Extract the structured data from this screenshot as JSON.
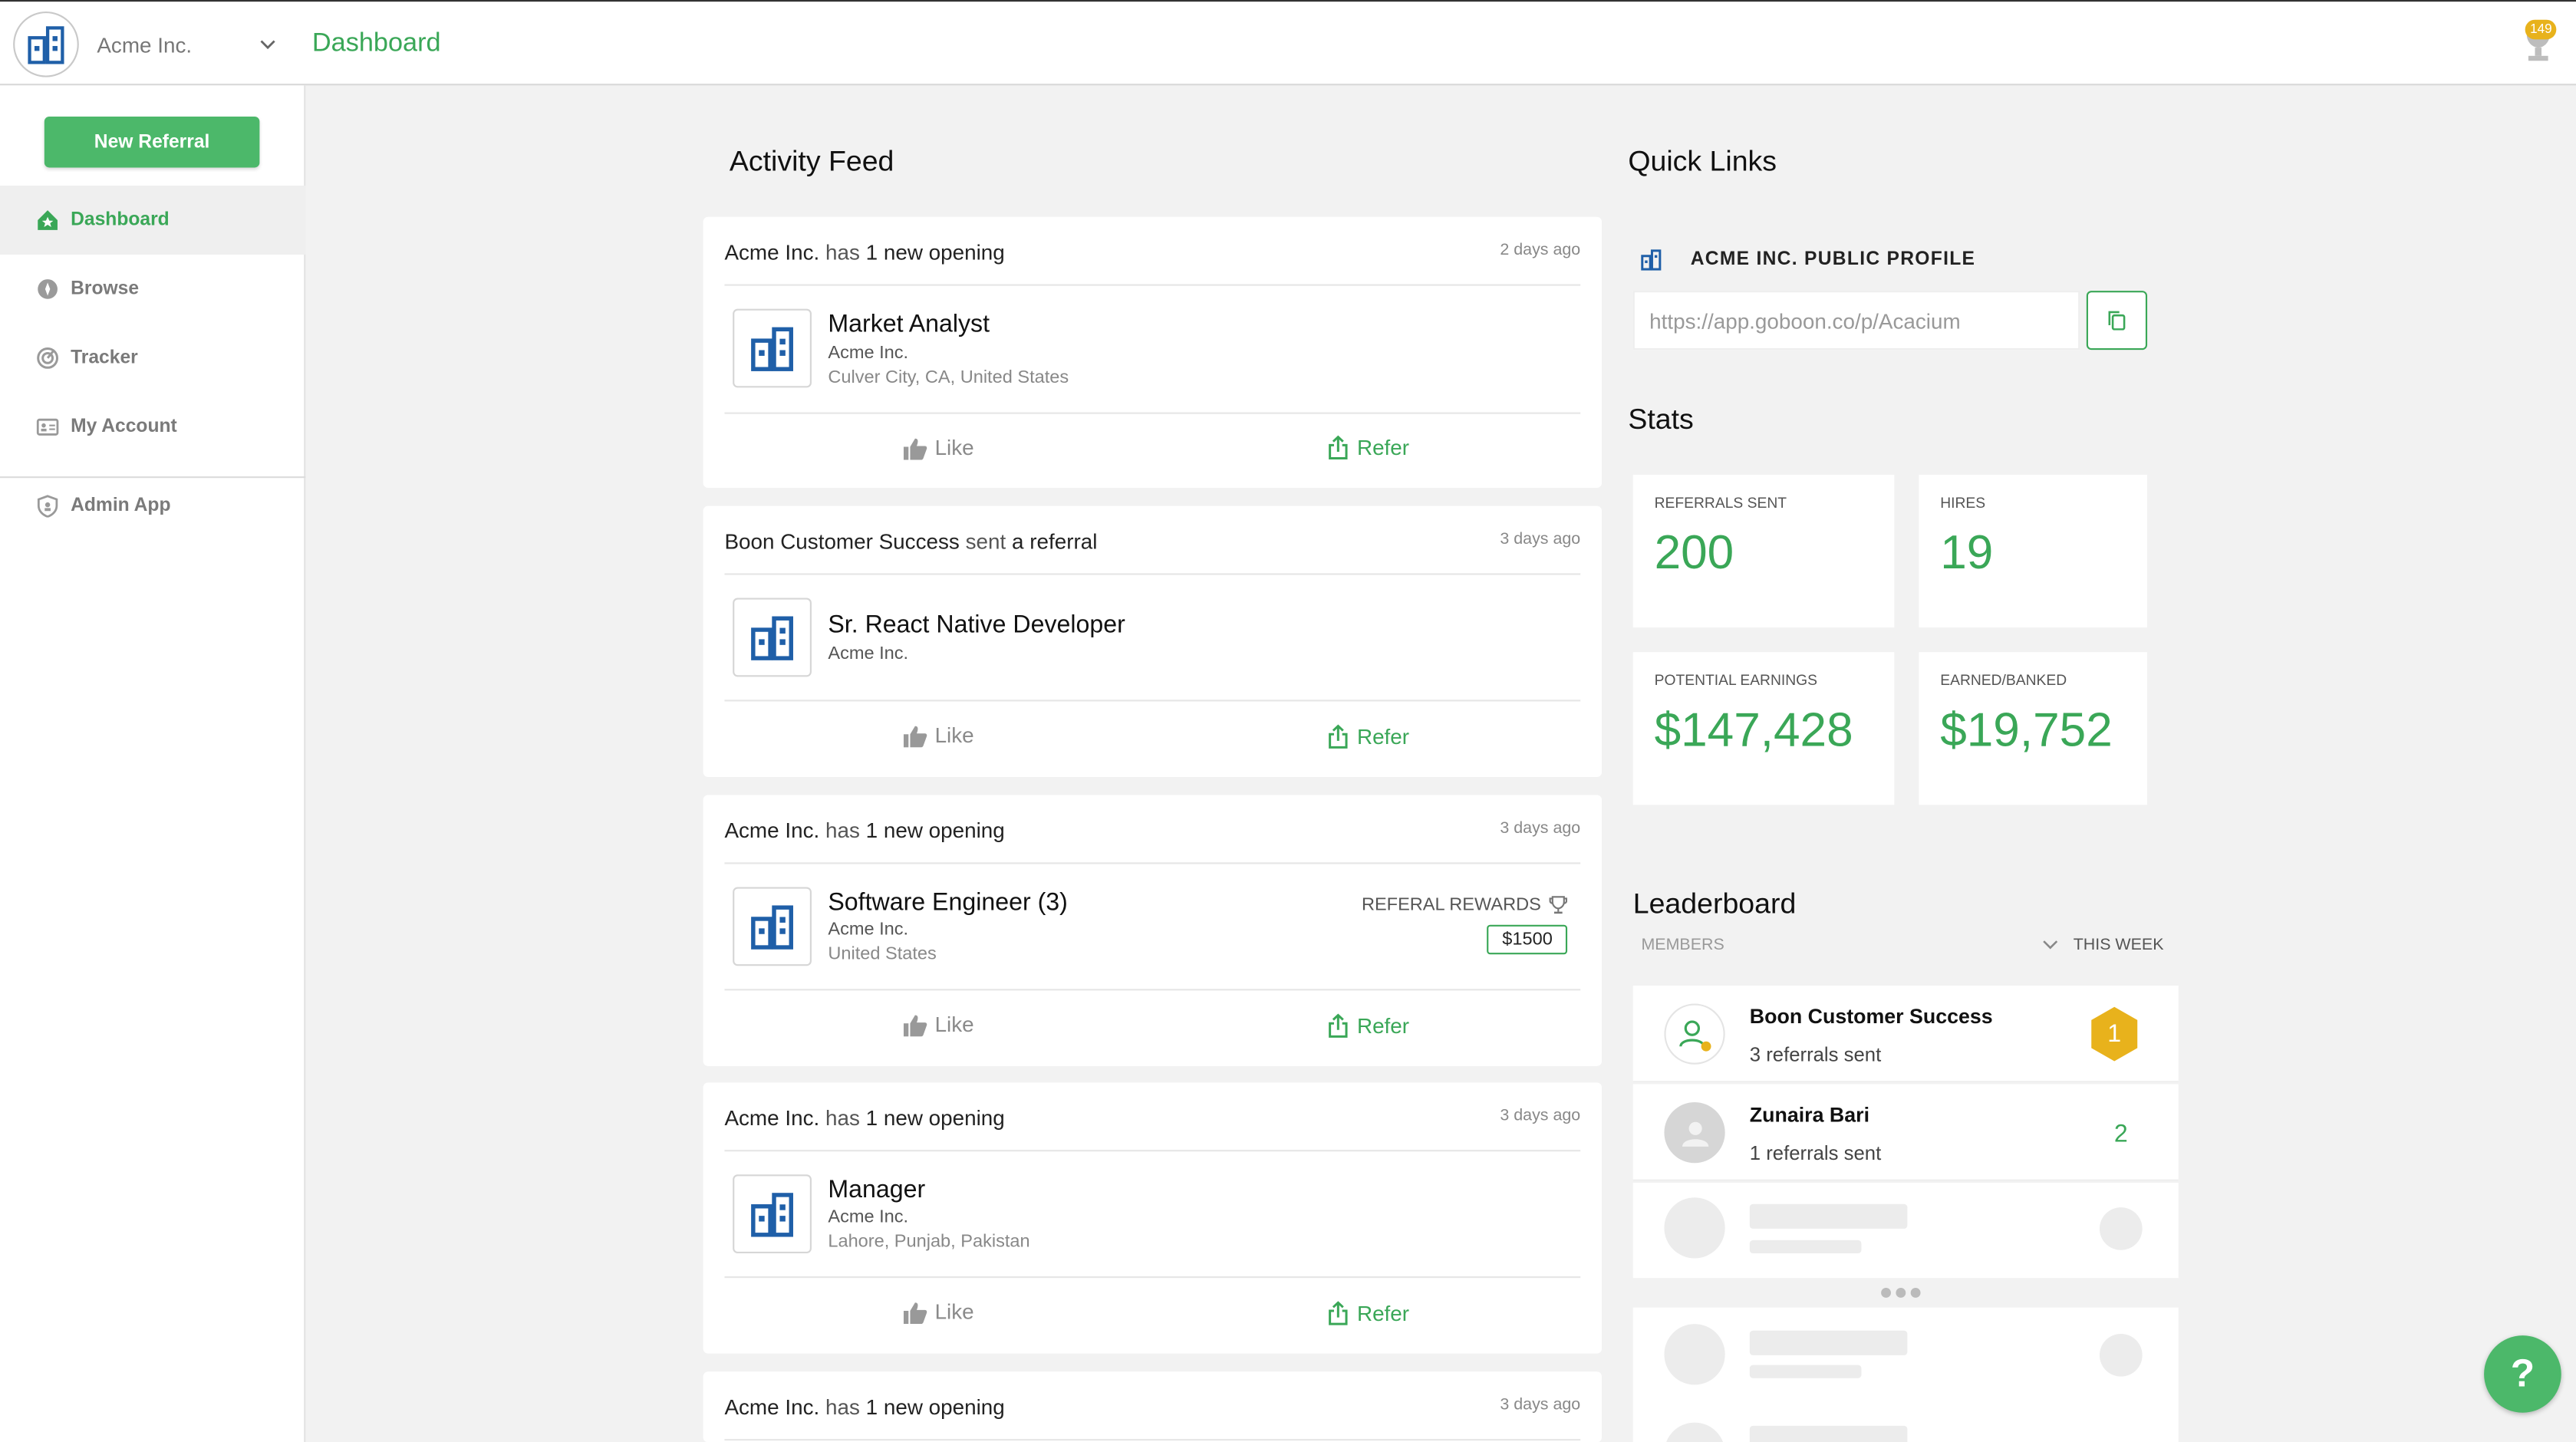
{
  "header": {
    "org_name": "Acme Inc.",
    "title": "Dashboard",
    "notification_count": "149"
  },
  "sidebar": {
    "new_referral": "New Referral",
    "items": [
      {
        "label": "Dashboard",
        "icon": "home-icon",
        "active": true
      },
      {
        "label": "Browse",
        "icon": "compass-icon"
      },
      {
        "label": "Tracker",
        "icon": "radar-icon"
      },
      {
        "label": "My Account",
        "icon": "id-card-icon"
      },
      {
        "label": "Admin App",
        "icon": "shield-icon"
      }
    ]
  },
  "feed": {
    "title": "Activity Feed",
    "like_label": "Like",
    "refer_label": "Refer",
    "cards": [
      {
        "actor": "Acme Inc.",
        "verb": "has",
        "object": "1 new opening",
        "time": "2 days ago",
        "job_title": "Market Analyst",
        "company": "Acme Inc.",
        "location": "Culver City, CA, United States"
      },
      {
        "actor": "Boon Customer Success",
        "verb": "sent",
        "object": "a referral",
        "time": "3 days ago",
        "job_title": "Sr. React Native Developer",
        "company": "Acme Inc.",
        "location": ""
      },
      {
        "actor": "Acme Inc.",
        "verb": "has",
        "object": "1 new opening",
        "time": "3 days ago",
        "job_title": "Software Engineer (3)",
        "company": "Acme Inc.",
        "location": "United States",
        "rewards_label": "REFERAL REWARDS",
        "rewards_amount": "$1500"
      },
      {
        "actor": "Acme Inc.",
        "verb": "has",
        "object": "1 new opening",
        "time": "3 days ago",
        "job_title": "Manager",
        "company": "Acme Inc.",
        "location": "Lahore, Punjab, Pakistan"
      },
      {
        "actor": "Acme Inc.",
        "verb": "has",
        "object": "1 new opening",
        "time": "3 days ago"
      }
    ]
  },
  "quick_links": {
    "title": "Quick Links",
    "profile_label": "ACME INC. PUBLIC PROFILE",
    "profile_url": "https://app.goboon.co/p/Acacium"
  },
  "stats": {
    "title": "Stats",
    "items": [
      {
        "label": "REFERRALS SENT",
        "value": "200"
      },
      {
        "label": "HIRES",
        "value": "19"
      },
      {
        "label": "POTENTIAL EARNINGS",
        "value": "$147,428"
      },
      {
        "label": "EARNED/BANKED",
        "value": "$19,752"
      }
    ]
  },
  "leaderboard": {
    "title": "Leaderboard",
    "members_label": "MEMBERS",
    "period": "THIS WEEK",
    "rows": [
      {
        "name": "Boon Customer Success",
        "sub": "3 referrals sent",
        "rank": "1"
      },
      {
        "name": "Zunaira Bari",
        "sub": "1 referrals sent",
        "rank": "2"
      }
    ]
  },
  "help": {
    "label": "?"
  },
  "colors": {
    "accent": "#3aa757",
    "button": "#4cb86a",
    "badge": "#e8b21c",
    "logo_blue": "#1f5fa8"
  }
}
